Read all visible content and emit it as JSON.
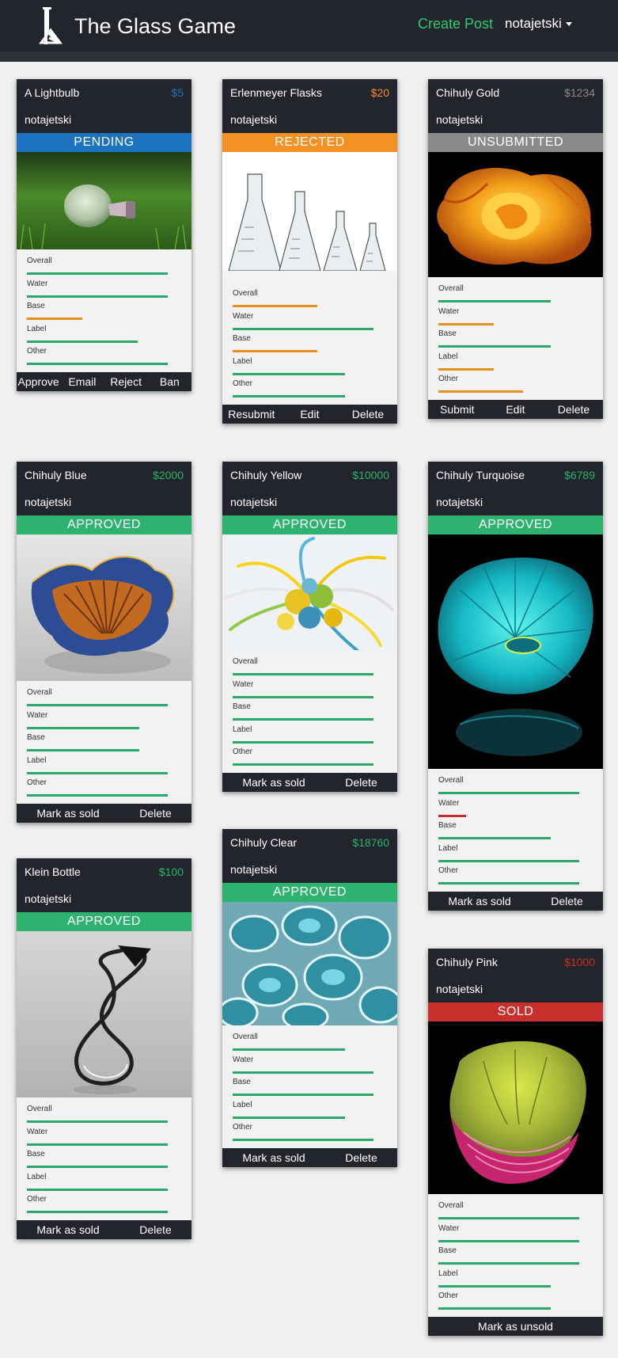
{
  "app": {
    "title": "The Glass Game"
  },
  "nav": {
    "create_post": "Create Post",
    "user": "notajetski"
  },
  "colors": {
    "pending": "#1e73be",
    "rejected": "#f39224",
    "unsubmitted": "#8a8a8a",
    "approved": "#2db36f",
    "sold": "#c9302c",
    "bar_green": "#2aa86a",
    "bar_orange": "#e98d23",
    "bar_red": "#c42b2b"
  },
  "rating_labels": [
    "Overall",
    "Water",
    "Base",
    "Label",
    "Other"
  ],
  "cards": [
    {
      "title": "A Lightbulb",
      "price": "$5",
      "price_color": "#1e73be",
      "owner": "notajetski",
      "status": "PENDING",
      "status_color": "#1e73be",
      "image": "lightbulb-image",
      "ratings": [
        {
          "level": 0.92,
          "color": "#2aa86a"
        },
        {
          "level": 0.92,
          "color": "#2aa86a"
        },
        {
          "level": 0.36,
          "color": "#e98d23"
        },
        {
          "level": 0.72,
          "color": "#2aa86a"
        },
        {
          "level": 0.92,
          "color": "#2aa86a"
        }
      ],
      "buttons": [
        "Approve",
        "Email",
        "Reject",
        "Ban"
      ]
    },
    {
      "title": "Erlenmeyer Flasks",
      "price": "$20",
      "price_color": "#f39224",
      "owner": "notajetski",
      "status": "REJECTED",
      "status_color": "#f39224",
      "image": "flasks-image",
      "ratings": [
        {
          "level": 0.55,
          "color": "#e98d23"
        },
        {
          "level": 0.92,
          "color": "#2aa86a"
        },
        {
          "level": 0.55,
          "color": "#e98d23"
        },
        {
          "level": 0.73,
          "color": "#2aa86a"
        },
        {
          "level": 0.73,
          "color": "#2aa86a"
        }
      ],
      "buttons": [
        "Resubmit",
        "Edit",
        "Delete"
      ]
    },
    {
      "title": "Chihuly Gold",
      "price": "$1234",
      "price_color": "#8a8a8a",
      "owner": "notajetski",
      "status": "UNSUBMITTED",
      "status_color": "#8a8a8a",
      "image": "gold-image",
      "ratings": [
        {
          "level": 0.73,
          "color": "#2aa86a"
        },
        {
          "level": 0.36,
          "color": "#e98d23"
        },
        {
          "level": 0.73,
          "color": "#2aa86a"
        },
        {
          "level": 0.36,
          "color": "#e98d23"
        },
        {
          "level": 0.55,
          "color": "#e98d23"
        }
      ],
      "buttons": [
        "Submit",
        "Edit",
        "Delete"
      ]
    },
    {
      "title": "Chihuly Blue",
      "price": "$2000",
      "price_color": "#2db36f",
      "owner": "notajetski",
      "status": "APPROVED",
      "status_color": "#2db36f",
      "image": "blue-image",
      "ratings": [
        {
          "level": 0.92,
          "color": "#2aa86a"
        },
        {
          "level": 0.73,
          "color": "#2aa86a"
        },
        {
          "level": 0.73,
          "color": "#2aa86a"
        },
        {
          "level": 0.92,
          "color": "#2aa86a"
        },
        {
          "level": 0.92,
          "color": "#2aa86a"
        }
      ],
      "buttons": [
        "Mark as sold",
        "Delete"
      ]
    },
    {
      "title": "Chihuly Yellow",
      "price": "$10000",
      "price_color": "#2db36f",
      "owner": "notajetski",
      "status": "APPROVED",
      "status_color": "#2db36f",
      "image": "yellow-image",
      "ratings": [
        {
          "level": 0.92,
          "color": "#2aa86a"
        },
        {
          "level": 0.92,
          "color": "#2aa86a"
        },
        {
          "level": 0.92,
          "color": "#2aa86a"
        },
        {
          "level": 0.92,
          "color": "#2aa86a"
        },
        {
          "level": 0.92,
          "color": "#2aa86a"
        }
      ],
      "buttons": [
        "Mark as sold",
        "Delete"
      ]
    },
    {
      "title": "Chihuly Turquoise",
      "price": "$6789",
      "price_color": "#2db36f",
      "owner": "notajetski",
      "status": "APPROVED",
      "status_color": "#2db36f",
      "image": "turquoise-image",
      "ratings": [
        {
          "level": 0.92,
          "color": "#2aa86a"
        },
        {
          "level": 0.18,
          "color": "#c42b2b"
        },
        {
          "level": 0.73,
          "color": "#2aa86a"
        },
        {
          "level": 0.92,
          "color": "#2aa86a"
        },
        {
          "level": 0.92,
          "color": "#2aa86a"
        }
      ],
      "buttons": [
        "Mark as sold",
        "Delete"
      ]
    },
    {
      "title": "Klein Bottle",
      "price": "$100",
      "price_color": "#2db36f",
      "owner": "notajetski",
      "status": "APPROVED",
      "status_color": "#2db36f",
      "image": "klein-bottle-image",
      "ratings": [
        {
          "level": 0.92,
          "color": "#2aa86a"
        },
        {
          "level": 0.92,
          "color": "#2aa86a"
        },
        {
          "level": 0.92,
          "color": "#2aa86a"
        },
        {
          "level": 0.92,
          "color": "#2aa86a"
        },
        {
          "level": 0.92,
          "color": "#2aa86a"
        }
      ],
      "buttons": [
        "Mark as sold",
        "Delete"
      ]
    },
    {
      "title": "Chihuly Clear",
      "price": "$18760",
      "price_color": "#2db36f",
      "owner": "notajetski",
      "status": "APPROVED",
      "status_color": "#2db36f",
      "image": "clear-image",
      "ratings": [
        {
          "level": 0.73,
          "color": "#2aa86a"
        },
        {
          "level": 0.92,
          "color": "#2aa86a"
        },
        {
          "level": 0.92,
          "color": "#2aa86a"
        },
        {
          "level": 0.73,
          "color": "#2aa86a"
        },
        {
          "level": 0.92,
          "color": "#2aa86a"
        }
      ],
      "buttons": [
        "Mark as sold",
        "Delete"
      ]
    },
    {
      "title": "Chihuly Pink",
      "price": "$1000",
      "price_color": "#c9302c",
      "owner": "notajetski",
      "status": "SOLD",
      "status_color": "#c9302c",
      "image": "pink-image",
      "ratings": [
        {
          "level": 0.92,
          "color": "#2aa86a"
        },
        {
          "level": 0.92,
          "color": "#2aa86a"
        },
        {
          "level": 0.92,
          "color": "#2aa86a"
        },
        {
          "level": 0.73,
          "color": "#2aa86a"
        },
        {
          "level": 0.73,
          "color": "#2aa86a"
        }
      ],
      "buttons": [
        "Mark as unsold"
      ]
    }
  ]
}
